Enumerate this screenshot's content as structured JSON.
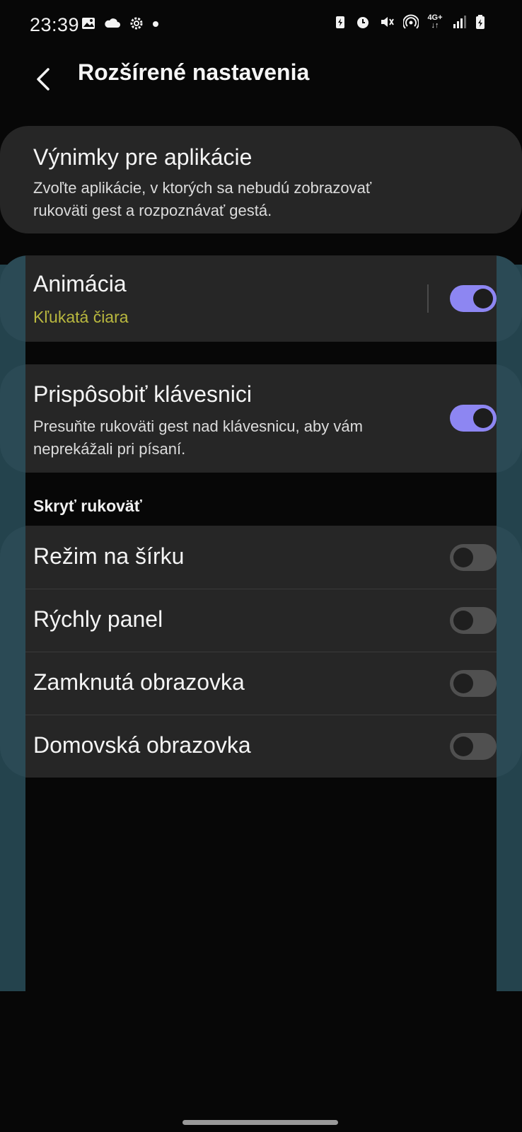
{
  "status_bar": {
    "time": "23:39",
    "left_icons": [
      "image-icon",
      "cloud-icon",
      "gear-icon",
      "dot-icon"
    ],
    "right_icons": [
      "battery-saver-icon",
      "alarm-icon",
      "mute-icon",
      "hotspot-icon",
      "network-4g-icon",
      "signal-icon",
      "battery-icon"
    ],
    "network_label": "4G+"
  },
  "header": {
    "title": "Rozšírené nastavenia"
  },
  "app_exceptions": {
    "title": "Výnimky pre aplikácie",
    "description": "Zvoľte aplikácie, v ktorých sa nebudú zobrazovať rukoväti gest a rozpoznávať gestá."
  },
  "animation": {
    "title": "Animácia",
    "value": "Kľukatá čiara",
    "enabled": true
  },
  "keyboard": {
    "title": "Prispôsobiť klávesnici",
    "description": "Presuňte rukoväti gest nad klávesnicu, aby vám neprekážali pri písaní.",
    "enabled": true
  },
  "hide_handle": {
    "section_title": "Skryť rukoväť",
    "items": [
      {
        "label": "Režim na šírku",
        "enabled": false
      },
      {
        "label": "Rýchly panel",
        "enabled": false
      },
      {
        "label": "Zamknutá obrazovka",
        "enabled": false
      },
      {
        "label": "Domovská obrazovka",
        "enabled": false
      }
    ]
  },
  "colors": {
    "accent_toggle": "#8d86f2",
    "accent_text": "#b9b83f",
    "highlight": "#2b4a55"
  }
}
